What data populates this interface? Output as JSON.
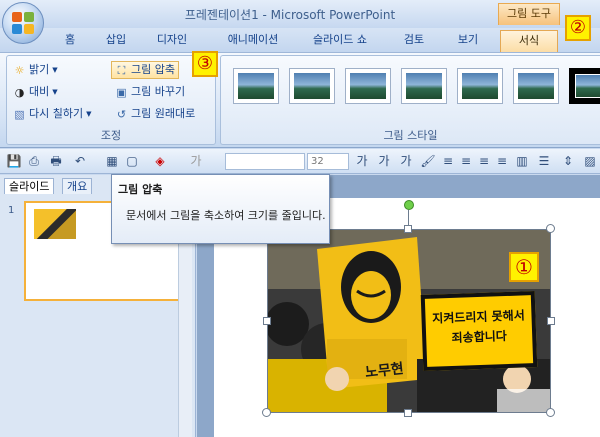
{
  "window": {
    "title": "프레젠테이션1 - Microsoft PowerPoint"
  },
  "contextual_tab": {
    "label": "그림 도구"
  },
  "tabs": [
    "홈",
    "삽입",
    "디자인",
    "애니메이션",
    "슬라이드 쇼",
    "검토",
    "보기",
    "서식"
  ],
  "active_tab": "서식",
  "ribbon": {
    "adjust_group": {
      "label": "조정",
      "brightness": "밝기",
      "contrast": "대비",
      "recolor": "다시 칠하기",
      "compress": "그림 압축",
      "change_picture": "그림 바꾸기",
      "reset_picture": "그림 원래대로"
    },
    "style_group": {
      "label": "그림 스타일",
      "style_count": 7
    }
  },
  "qat": {
    "font_size": "32"
  },
  "left_pane": {
    "tabs": [
      "슬라이드",
      "개요"
    ],
    "slide_number": "1"
  },
  "tooltip": {
    "title": "그림 압축",
    "body": "문서에서 그림을 축소하여 크기를 줄입니다."
  },
  "slide_image": {
    "sign_line1": "지켜드리지 못해서",
    "sign_line2": "죄송합니다",
    "poster_text": "노무현"
  },
  "callouts": [
    "①",
    "②",
    "③"
  ],
  "colors": {
    "accent": "#ffcc00",
    "badge_text": "#c00000",
    "selection": "#6fcf4a"
  }
}
